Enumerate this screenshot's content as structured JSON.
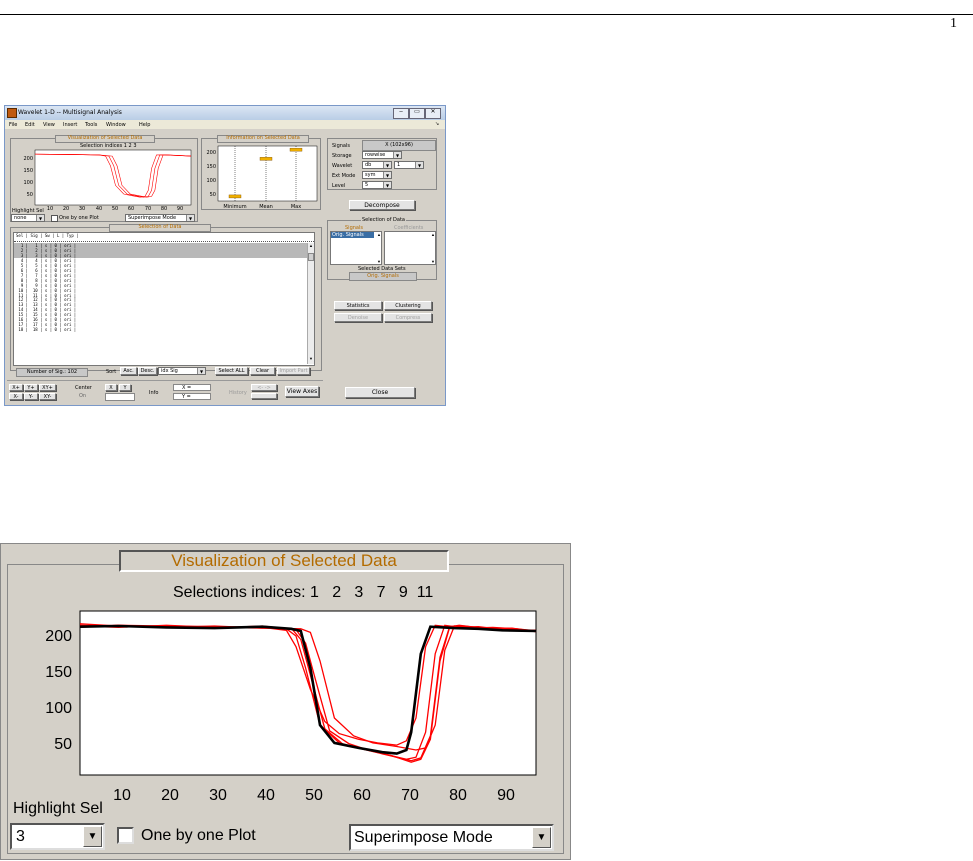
{
  "page_number": "1",
  "window": {
    "title": "Wavelet 1-D -- Multisignal Analysis",
    "menu": [
      "File",
      "Edit",
      "View",
      "Insert",
      "Tools",
      "Window",
      "Help"
    ],
    "menu_end": "↘",
    "vis_title": "Visualization of Selected Data",
    "vis_selection": "Selection indices 1  2  3",
    "vis_yticks": [
      "200",
      "150",
      "100",
      "50"
    ],
    "vis_xticks": [
      "10",
      "20",
      "30",
      "40",
      "50",
      "60",
      "70",
      "80",
      "90"
    ],
    "highlight_label": "Highlight Sel",
    "highlight_value": "none",
    "one_by_one": "One by one Plot",
    "mode": "Superimpose Mode",
    "info_title": "Information on Selected Data",
    "info_yticks": [
      "200",
      "150",
      "100",
      "50"
    ],
    "info_xlabels": [
      "Minimum",
      "Mean",
      "Max"
    ],
    "sel_title": "Selection of Data",
    "table_header": "Sel | Sig | Sw | L | Typ |",
    "table_rows": [
      "  1 |   1 | s | 0 | ori |",
      "  2 |   2 | s | 0 | ori |",
      "  3 |   3 | s | 0 | ori |",
      "  4 |   4 | s | 0 | ori |",
      "  5 |   5 | s | 0 | ori |",
      "  6 |   6 | s | 0 | ori |",
      "  7 |   7 | s | 0 | ori |",
      "  8 |   8 | s | 0 | ori |",
      "  9 |   9 | s | 0 | ori |",
      " 10 |  10 | s | 0 | ori |",
      " 11 |  11 | s | 0 | ori |",
      " 12 |  12 | s | 0 | ori |",
      " 13 |  13 | s | 0 | ori |",
      " 14 |  14 | s | 0 | ori |",
      " 15 |  15 | s | 0 | ori |",
      " 16 |  16 | s | 0 | ori |",
      " 17 |  17 | s | 0 | ori |",
      " 18 |  18 | s | 0 | ori |"
    ],
    "number_of_sig": "Number of Sig.: 102",
    "sort_label": "Sort",
    "asc": "Asc.",
    "desc": "Desc.",
    "sort_by": "idx Sig",
    "select_all": "Select ALL",
    "clear": "Clear",
    "import_part": "Import Part",
    "zoom_buttons": [
      "X+",
      "Y+",
      "XY+",
      "X-",
      "Y-",
      "XY-"
    ],
    "center_label": "Center",
    "center_value": "On",
    "center_x": "X",
    "center_y": "Y",
    "info_label": "Info",
    "info_x": "X =",
    "info_y": "Y =",
    "history": "History",
    "history_arrows": "<- ->",
    "view_axes": "View Axes",
    "right": {
      "signals_label": "Signals",
      "signals_value": "X (102x96)",
      "storage_label": "Storage",
      "storage_value": "rowwise",
      "wavelet_label": "Wavelet",
      "wavelet_family": "db",
      "wavelet_num": "1",
      "extmode_label": "Ext Mode",
      "extmode_value": "sym",
      "level_label": "Level",
      "level_value": "5",
      "decompose": "Decompose",
      "sel_data_title": "Selection of Data",
      "signals_col": "Signals",
      "coefficients_col": "Coefficients",
      "list_item": "Orig. Signals",
      "selected_sets_label": "Selected Data Sets",
      "selected_sets_value": "Orig. Signals",
      "statistics": "Statistics",
      "clustering": "Clustering",
      "denoise": "Denoise",
      "compress": "Compress",
      "close": "Close"
    }
  },
  "zoom": {
    "title": "Visualization of Selected Data",
    "selections": "Selections indices: 1   2   3   7   9  11",
    "yticks": [
      "200",
      "150",
      "100",
      "50"
    ],
    "xticks": [
      "10",
      "20",
      "30",
      "40",
      "50",
      "60",
      "70",
      "80",
      "90"
    ],
    "highlight_label": "Highlight Sel",
    "highlight_value": "3",
    "one_by_one": "One by one Plot",
    "mode": "Superimpose Mode"
  },
  "colors": {
    "panel_bg": "#d4d0c8",
    "title_orange": "#b36b00",
    "signal_red": "#ff0000",
    "highlight_black": "#000000",
    "title_bar": "#c8d8ec"
  },
  "chart_data": [
    {
      "type": "line",
      "title": "Visualization of Selected Data",
      "xlim": [
        1,
        96
      ],
      "ylim": [
        0,
        225
      ],
      "series": [
        {
          "color": "#ff0000",
          "x": [
            1,
            20,
            40,
            44,
            47,
            50,
            55,
            60,
            65,
            68,
            70,
            72,
            75,
            80,
            96
          ],
          "y": [
            208,
            207,
            205,
            200,
            160,
            80,
            45,
            38,
            32,
            35,
            60,
            150,
            205,
            205,
            200
          ]
        },
        {
          "color": "#ff0000",
          "x": [
            1,
            20,
            40,
            46,
            49,
            52,
            57,
            62,
            67,
            70,
            72,
            74,
            77,
            80,
            96
          ],
          "y": [
            208,
            207,
            205,
            200,
            160,
            80,
            45,
            38,
            32,
            35,
            60,
            150,
            205,
            205,
            200
          ]
        },
        {
          "color": "#ff0000",
          "x": [
            1,
            20,
            40,
            48,
            51,
            54,
            59,
            64,
            69,
            72,
            74,
            76,
            79,
            82,
            96
          ],
          "y": [
            208,
            207,
            205,
            200,
            160,
            80,
            45,
            38,
            32,
            35,
            60,
            150,
            205,
            205,
            200
          ]
        }
      ]
    },
    {
      "type": "scatter",
      "title": "Information on Selected Data",
      "categories": [
        "Minimum",
        "Mean",
        "Max"
      ],
      "values": [
        55,
        178,
        208
      ],
      "ylim": [
        40,
        220
      ]
    },
    {
      "type": "line",
      "title": "Visualization of Selected Data",
      "xlim": [
        2,
        97
      ],
      "ylim": [
        0,
        230
      ],
      "series": [
        {
          "color": "#ff0000",
          "x": [
            2,
            10,
            20,
            30,
            40,
            45,
            47,
            49,
            52,
            56,
            60,
            65,
            70,
            72,
            74,
            76,
            78,
            80,
            85,
            90,
            97
          ],
          "y": [
            210,
            208,
            209,
            207,
            208,
            205,
            195,
            150,
            70,
            45,
            38,
            30,
            22,
            25,
            60,
            170,
            210,
            208,
            207,
            205,
            202
          ]
        },
        {
          "color": "#ff0000",
          "x": [
            2,
            10,
            20,
            30,
            40,
            46,
            48,
            50,
            53,
            57,
            61,
            66,
            71,
            73,
            75,
            77,
            79,
            81,
            86,
            91,
            97
          ],
          "y": [
            208,
            210,
            207,
            209,
            206,
            206,
            190,
            140,
            65,
            42,
            36,
            28,
            20,
            24,
            55,
            165,
            208,
            210,
            206,
            204,
            203
          ]
        },
        {
          "color": "#ff0000",
          "x": [
            2,
            10,
            20,
            30,
            40,
            47,
            49,
            51,
            54,
            58,
            62,
            67,
            71,
            73,
            75,
            77,
            79,
            82,
            87,
            92,
            97
          ],
          "y": [
            212,
            209,
            208,
            206,
            209,
            204,
            185,
            135,
            62,
            44,
            35,
            27,
            18,
            22,
            50,
            160,
            207,
            209,
            205,
            206,
            201
          ]
        },
        {
          "color": "#ff0000",
          "x": [
            2,
            10,
            20,
            30,
            40,
            45,
            47,
            50,
            53,
            56,
            60,
            64,
            68,
            70,
            72,
            74,
            76,
            80,
            85,
            90,
            97
          ],
          "y": [
            207,
            210,
            209,
            208,
            207,
            203,
            180,
            120,
            75,
            58,
            50,
            45,
            42,
            48,
            80,
            180,
            210,
            207,
            208,
            204,
            203
          ]
        },
        {
          "color": "#ff0000",
          "x": [
            2,
            10,
            20,
            30,
            40,
            48,
            50,
            52,
            55,
            59,
            63,
            68,
            72,
            74,
            76,
            78,
            80,
            83,
            88,
            93,
            97
          ],
          "y": [
            209,
            207,
            210,
            207,
            206,
            205,
            200,
            160,
            80,
            55,
            45,
            40,
            35,
            38,
            70,
            175,
            209,
            206,
            207,
            205,
            202
          ]
        },
        {
          "color": "#000000",
          "x": [
            2,
            10,
            20,
            30,
            40,
            46,
            48,
            50,
            52,
            55,
            60,
            65,
            68,
            70,
            71,
            73,
            75,
            80,
            85,
            90,
            97
          ],
          "y": [
            208,
            209,
            207,
            206,
            208,
            205,
            202,
            150,
            70,
            45,
            38,
            32,
            30,
            35,
            60,
            170,
            208,
            206,
            205,
            203,
            202
          ]
        }
      ]
    }
  ]
}
